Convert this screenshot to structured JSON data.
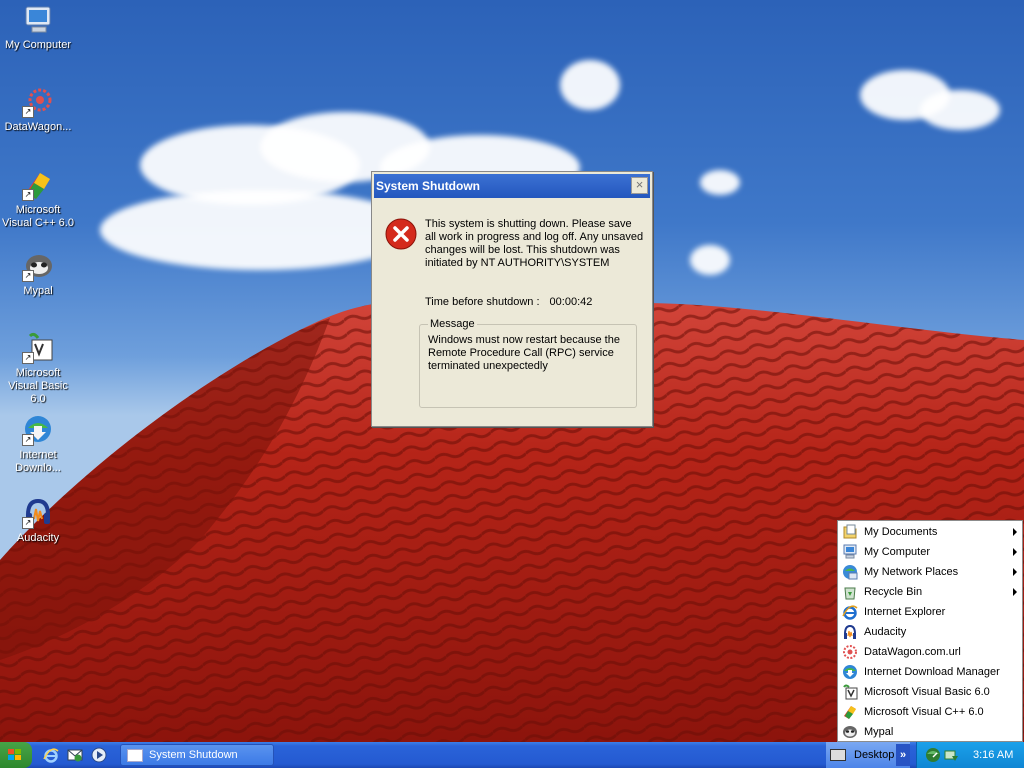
{
  "desktop": {
    "icons": [
      {
        "label": "My Computer",
        "icon": "computer-icon"
      },
      {
        "label": "DataWagon...",
        "icon": "datawagon-icon"
      },
      {
        "label": "Microsoft Visual C++ 6.0",
        "icon": "visual-cpp-icon"
      },
      {
        "label": "Mypal",
        "icon": "mypal-icon"
      },
      {
        "label": "Microsoft Visual Basic 6.0",
        "icon": "visual-basic-icon"
      },
      {
        "label": "Internet Downlo...",
        "icon": "internet-download-manager-icon"
      },
      {
        "label": "Audacity",
        "icon": "audacity-icon"
      }
    ]
  },
  "dialog": {
    "title": "System Shutdown",
    "message": "This system is shutting down. Please save all work in progress and log off. Any unsaved changes will be lost. This shutdown was initiated by NT AUTHORITY\\SYSTEM",
    "time_label": "Time before shutdown :",
    "time_value": "00:00:42",
    "group_label": "Message",
    "reason": "Windows must now restart because the Remote Procedure Call (RPC) service terminated unexpectedly",
    "close_glyph": "×"
  },
  "menu": {
    "items": [
      {
        "label": "My Documents",
        "icon": "documents-icon",
        "submenu": true
      },
      {
        "label": "My Computer",
        "icon": "computer-icon",
        "submenu": true
      },
      {
        "label": "My Network Places",
        "icon": "network-icon",
        "submenu": true
      },
      {
        "label": "Recycle Bin",
        "icon": "recycle-bin-icon",
        "submenu": true
      },
      {
        "label": "Internet Explorer",
        "icon": "ie-icon",
        "submenu": false
      },
      {
        "label": "Audacity",
        "icon": "audacity-icon",
        "submenu": false
      },
      {
        "label": "DataWagon.com.url",
        "icon": "datawagon-icon",
        "submenu": false
      },
      {
        "label": "Internet Download Manager",
        "icon": "internet-download-manager-icon",
        "submenu": false
      },
      {
        "label": "Microsoft Visual Basic 6.0",
        "icon": "visual-basic-icon",
        "submenu": false
      },
      {
        "label": "Microsoft Visual C++ 6.0",
        "icon": "visual-cpp-icon",
        "submenu": false
      },
      {
        "label": "Mypal",
        "icon": "mypal-icon",
        "submenu": false
      }
    ]
  },
  "taskbar": {
    "task_label": "System Shutdown",
    "toolbar_label": "Desktop",
    "chevron": "»",
    "clock": "3:16 AM"
  },
  "colors": {
    "taskbar_blue": "#245ad1",
    "title_blue": "#2457be",
    "tray_blue": "#0f86d4",
    "dialog_bg": "#ece9d8",
    "error_red": "#d42a1c",
    "dune_red": "#b52418"
  }
}
